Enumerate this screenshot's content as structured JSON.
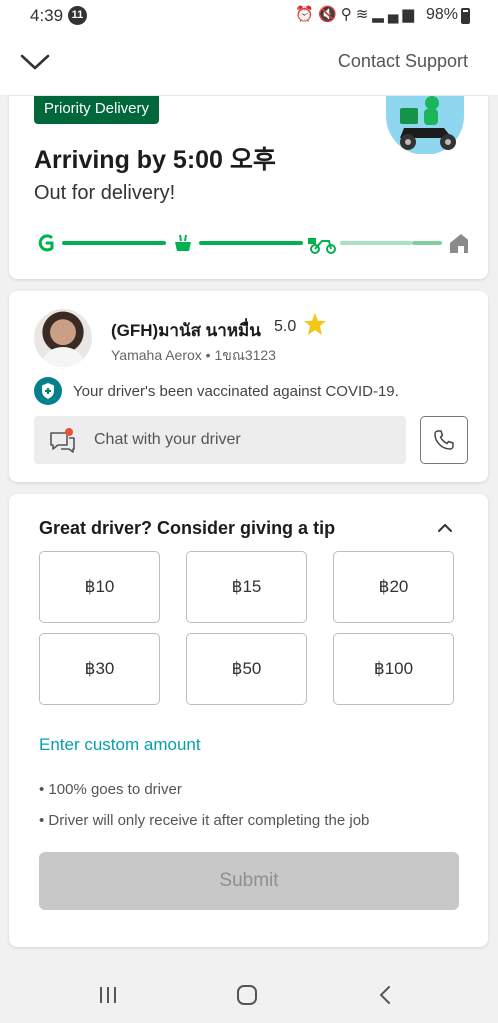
{
  "status_bar": {
    "time": "4:39",
    "notification_count": "11",
    "icons": [
      "alarm-icon",
      "mute-icon",
      "location-icon",
      "wifi-icon",
      "signal-icon"
    ],
    "battery": "98%"
  },
  "header": {
    "back_icon": "chevron-down-icon",
    "support_label": "Contact Support"
  },
  "delivery": {
    "badge": "Priority Delivery",
    "arriving_text": "Arriving by 5:00 오후",
    "status_text": "Out for delivery!",
    "progress_steps": [
      "grab-logo-icon",
      "food-bowl-icon",
      "scooter-icon",
      "home-icon"
    ],
    "progress_current_step": 3,
    "colors": {
      "accent": "#00b14f",
      "badge": "#00673b",
      "inactive": "#a7e1bd"
    }
  },
  "driver": {
    "name": "(GFH)มานัส นาหมื่น",
    "rating": "5.0",
    "vehicle": "Yamaha Aerox • 1ขณ3123",
    "vaccination_text": "Your driver's been vaccinated against COVID-19.",
    "chat_label": "Chat with your driver"
  },
  "tip": {
    "heading": "Great driver? Consider giving a tip",
    "options": [
      "฿10",
      "฿15",
      "฿20",
      "฿30",
      "฿50",
      "฿100"
    ],
    "custom_label": "Enter custom amount",
    "notes": [
      "• 100% goes to driver",
      "• Driver will only receive it after completing the job"
    ],
    "submit_label": "Submit",
    "link_color": "#05a0b0"
  },
  "nav": {
    "icons": [
      "recent-apps-icon",
      "home-button-icon",
      "back-icon"
    ]
  }
}
